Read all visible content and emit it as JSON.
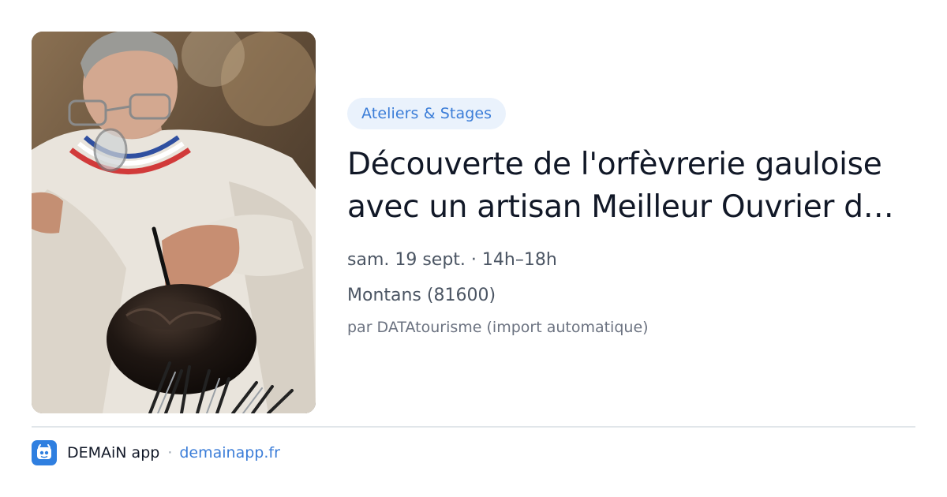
{
  "card": {
    "image_alt": "Artisan orfèvre au travail",
    "category": "Ateliers & Stages",
    "title": "Découverte de l'orfèvrerie gauloise avec un artisan Meilleur Ouvrier de France",
    "date": "sam. 19 sept. · 14h–18h",
    "location": "Montans (81600)",
    "source": "par DATAtourisme (import automatique)"
  },
  "footer": {
    "app_name": "DEMAiN app",
    "separator": "·",
    "link": "demainapp.fr",
    "logo_icon": "app-logo-icon"
  },
  "colors": {
    "accent": "#3b7dd8",
    "badge_bg": "#eaf2fc",
    "title": "#111827",
    "muted": "#4b5563",
    "divider": "#e1e6ea",
    "logo_bg": "#2f7fe0"
  }
}
